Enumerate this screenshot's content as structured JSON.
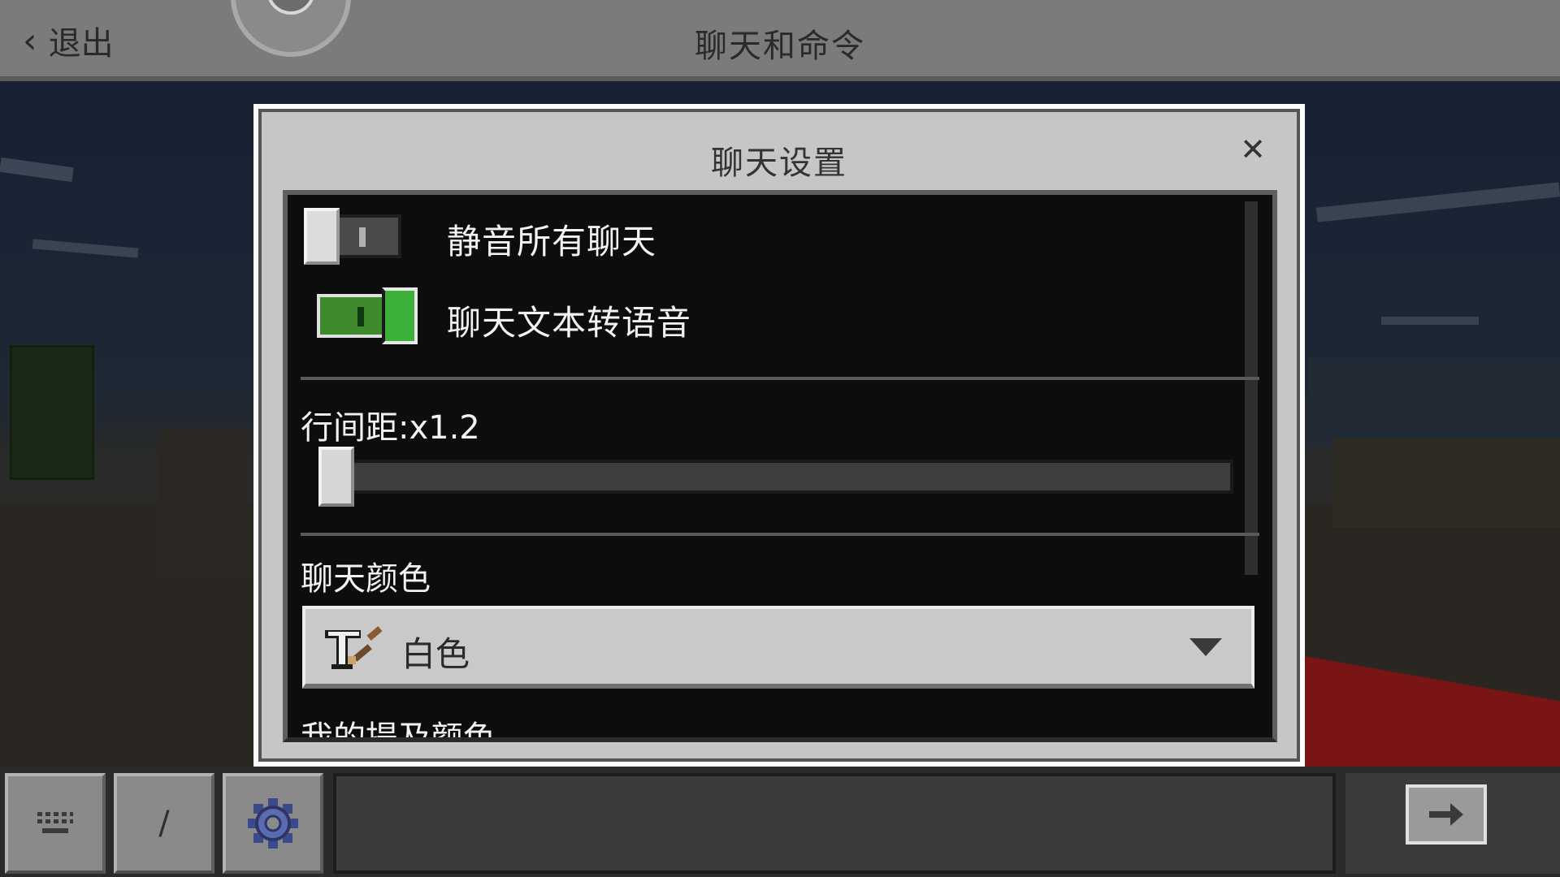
{
  "topbar": {
    "back_label": "退出",
    "back_icon": "chevron-left-icon",
    "title": "聊天和命令",
    "mic_icon": "microphone-icon"
  },
  "modal": {
    "title": "聊天设置",
    "close_icon": "close-icon",
    "mute_all_label": "静音所有聊天",
    "mute_all_on": false,
    "tts_label": "聊天文本转语音",
    "tts_on": true,
    "line_spacing_label": "行间距:x1.2",
    "line_spacing_value": 1.2,
    "chat_color_label": "聊天颜色",
    "chat_color_value": "白色",
    "chat_color_icon": "text-brush-icon",
    "mention_color_label": "我的提及颜色"
  },
  "bottombar": {
    "keyboard_icon": "keyboard-icon",
    "slash_label": "/",
    "settings_icon": "gear-icon",
    "send_icon": "send-arrow-icon"
  },
  "colors": {
    "toggle_on": "#3cb038",
    "panel_bg": "#0d0d0d",
    "modal_bg": "#c6c6c6"
  }
}
